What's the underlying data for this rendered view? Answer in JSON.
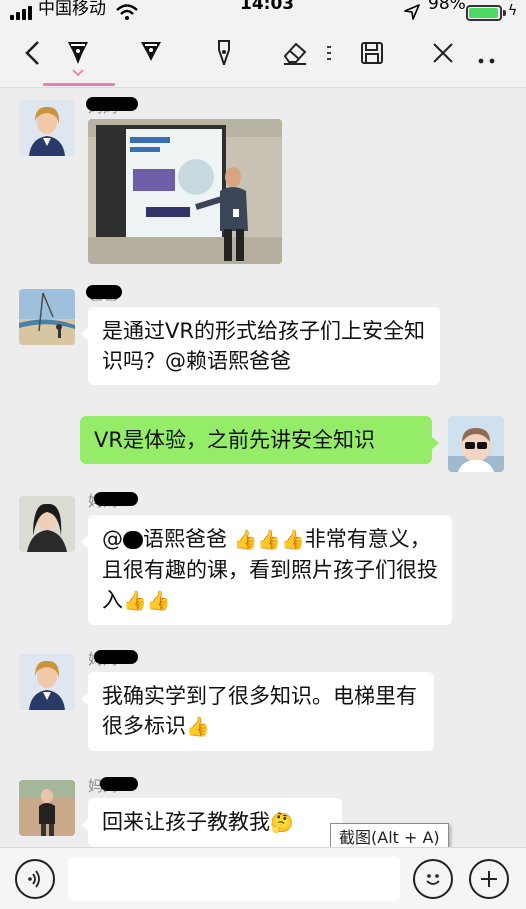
{
  "status_bar": {
    "carrier": "中国移动",
    "time": "14:03",
    "battery": "98%",
    "battery_level": 0.98
  },
  "toolbar": {
    "icons": [
      "back-icon",
      "pen-icon",
      "marker-icon",
      "fountain-pen-icon",
      "eraser-icon",
      "save-icon",
      "close-icon",
      "more-icon"
    ],
    "active_tool": "pen-icon"
  },
  "messages": [
    {
      "sender": "妈妈",
      "type": "image"
    },
    {
      "sender": "爸爸",
      "text": "是通过VR的形式给孩子们上安全知识吗？@赖语熙爸爸"
    },
    {
      "sender": "me",
      "text": "VR是体验，之前先讲安全知识"
    },
    {
      "sender": "妈妈",
      "text_prefix": "@",
      "text_main": "语熙爸爸",
      "text_rest": "非常有意义，且很有趣的课，看到照片孩子们很投入"
    },
    {
      "sender": "妈妈",
      "text": "我确实学到了很多知识。电梯里有很多标识"
    },
    {
      "sender": "妈妈",
      "text": "回来让孩子教教我"
    }
  ],
  "emoji": {
    "thumbs_up": "👍",
    "thinking": "🤔"
  },
  "tooltip": "截图(Alt + A)",
  "colors": {
    "accent": "#f07ab6",
    "my_bubble": "#95ec69",
    "their_bubble": "#ffffff",
    "background": "#ededed"
  }
}
